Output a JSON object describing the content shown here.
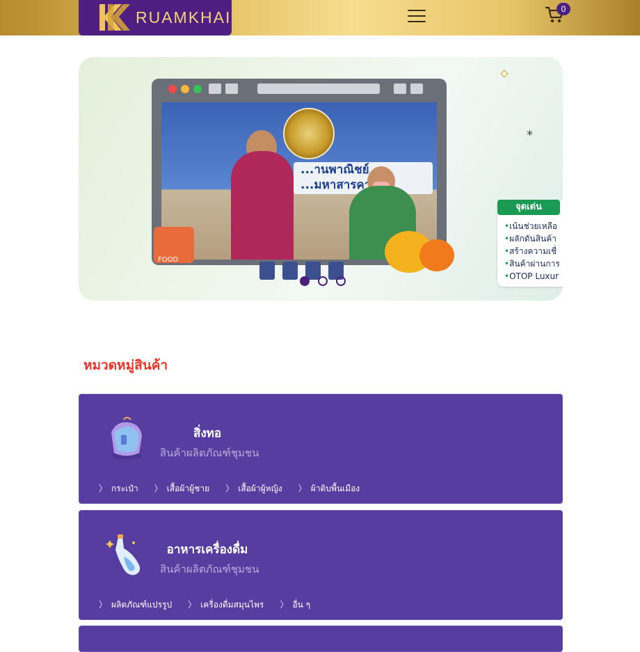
{
  "header": {
    "logo_text": "RUAMKHAI",
    "cart_count": "0",
    "menu_icon": "hamburger-icon",
    "cart_icon": "cart-icon"
  },
  "banner": {
    "sign_text": "...านพาณิชย์\n...มหาสารคาม",
    "stall_text": "FOOD",
    "highlight": {
      "tag": "จุดเด่น",
      "items": [
        "เน้นช่วยเหลือ",
        "ผลักดันสินค้า",
        "สร้างความเชื่",
        "สินค้าผ่านการ",
        "OTOP Luxur"
      ]
    },
    "carousel": {
      "count": 3,
      "active_index": 0
    }
  },
  "section": {
    "title": "หมวดหมู่สินค้า"
  },
  "categories": [
    {
      "title": "สิ่งทอ",
      "subtitle": "สินค้าผลิตภัณฑ์ชุมชน",
      "icon": "textile-bag-icon",
      "links": [
        "กระเป๋า",
        "เสื้อผ้าผู้ชาย",
        "เสื้อผ้าผู้หญิง",
        "ผ้าดิบพื้นเมือง"
      ]
    },
    {
      "title": "อาหารเครื่องดื่ม",
      "subtitle": "สินค้าผลิตภัณฑ์ชุมชน",
      "icon": "drink-bottle-icon",
      "links": [
        "ผลิตภัณฑ์แปรรูป",
        "เครื่องดื่มสมุนไพร",
        "อื่น ๆ"
      ]
    }
  ],
  "colors": {
    "brand_purple": "#4e1f80",
    "card_bg": "#563d9f",
    "section_title": "#e8362b",
    "header_gold": "#e2be5e"
  }
}
